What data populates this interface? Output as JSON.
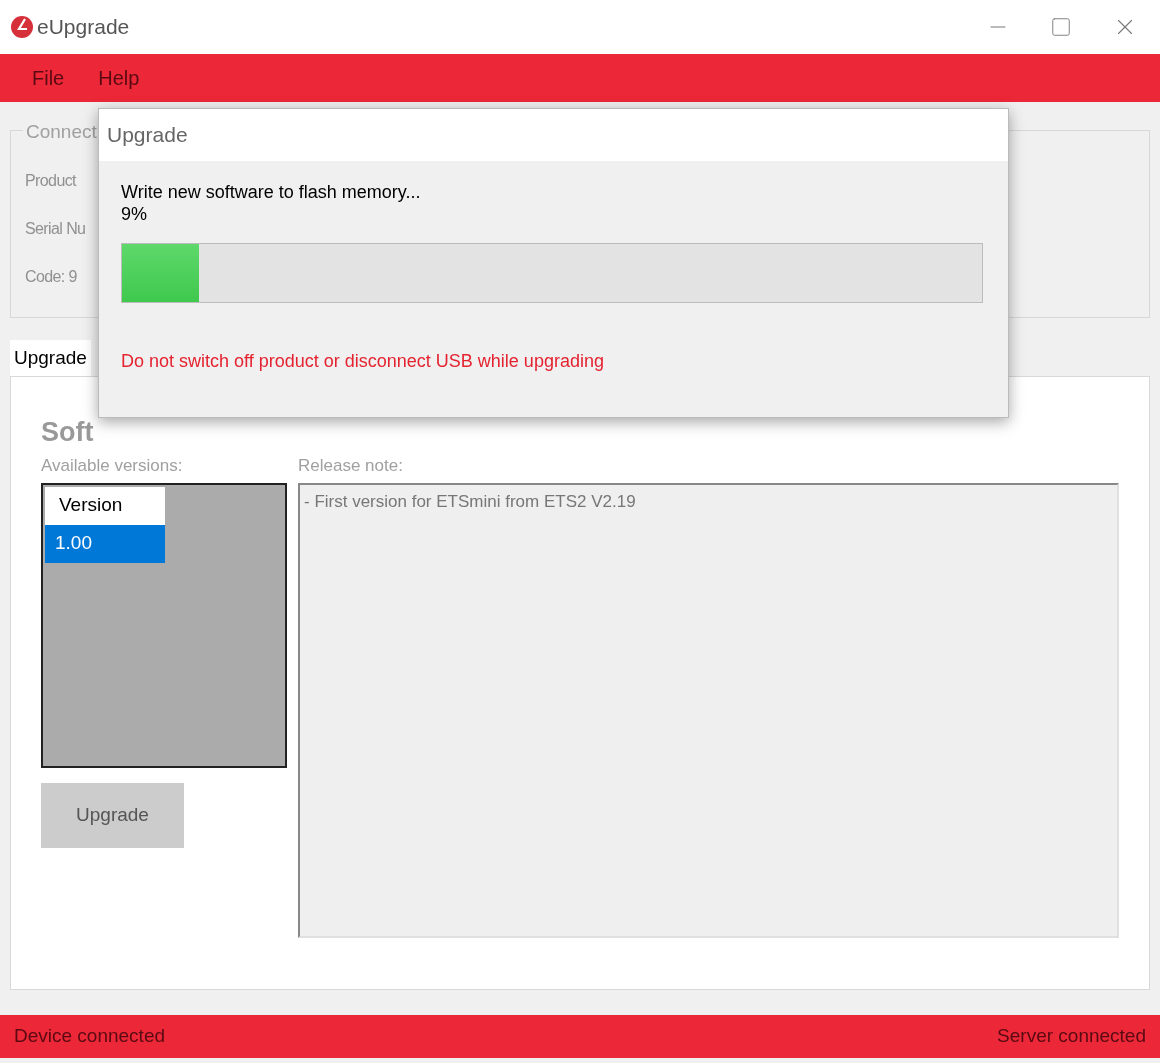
{
  "window": {
    "title": "eUpgrade"
  },
  "menu": [
    {
      "label": "File"
    },
    {
      "label": "Help"
    }
  ],
  "connection_group": {
    "legend": "Connect",
    "fields": [
      "Product",
      "Serial Nu",
      "Code: 9"
    ]
  },
  "tabs": [
    {
      "label": "Upgrade",
      "selected": true
    }
  ],
  "upgrade_panel": {
    "heading": "Soft",
    "versions_label": "Available versions:",
    "versions": {
      "column": "Version",
      "rows": [
        {
          "version": "1.00",
          "selected": true
        }
      ]
    },
    "release_note_label": "Release note:",
    "release_note": "- First version for ETSmini from ETS2 V2.19",
    "upgrade_button": {
      "label": "Upgrade",
      "disabled": true
    }
  },
  "dialog": {
    "title": "Upgrade",
    "message": "Write new software to flash memory...",
    "percent": "9%",
    "progress": {
      "level": 0.09
    },
    "warning": "Do not switch off product or disconnect USB while upgrading"
  },
  "status_bar": {
    "left": "Device connected",
    "right": "Server connected"
  }
}
